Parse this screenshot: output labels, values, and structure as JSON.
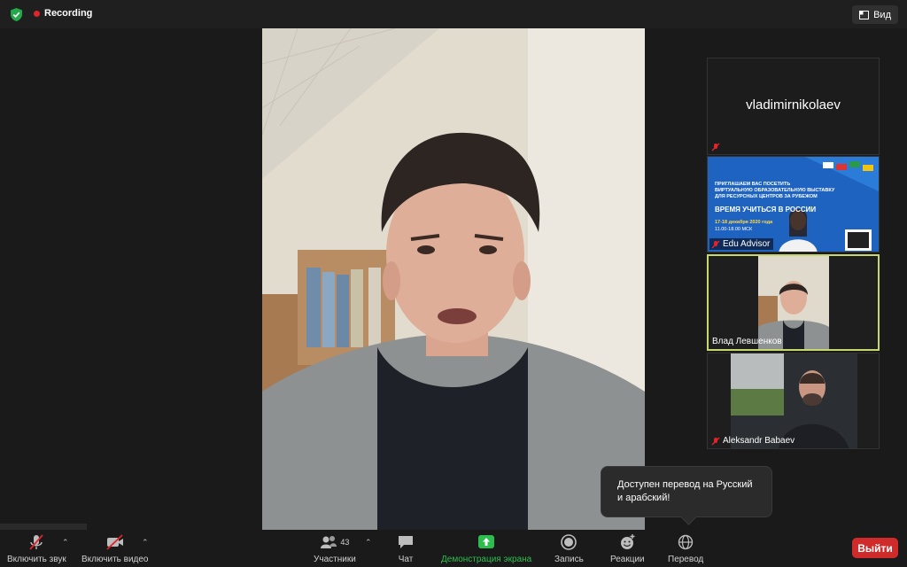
{
  "topbar": {
    "recording_label": "Recording",
    "view_label": "Вид"
  },
  "participants_panel": {
    "tiles": [
      {
        "name": "vladimirnikolaev",
        "muted": true
      },
      {
        "name": "Edu Advisor",
        "muted": true,
        "banner": {
          "line1": "ПРИГЛАШАЕМ ВАС ПОСЕТИТЬ",
          "line2": "ВИРТУАЛЬНУЮ ОБРАЗОВАТЕЛЬНУЮ ВЫСТАВКУ",
          "line3": "ДЛЯ РЕСУРСНЫХ ЦЕНТРОВ ЗА РУБЕЖОМ",
          "headline": "ВРЕМЯ УЧИТЬСЯ В РОССИИ",
          "dates": "17-18 декабря 2020 года",
          "hours": "11.00-18.00 МСК"
        }
      },
      {
        "name": "Влад Левшенков",
        "muted": false,
        "active_speaker": true
      },
      {
        "name": "Aleksandr Babaev",
        "muted": true
      }
    ]
  },
  "popup": {
    "text": "Доступен перевод на Русский и арабский!"
  },
  "toolbar": {
    "audio_label": "Включить звук",
    "video_label": "Включить видео",
    "participants_label": "Участники",
    "participants_count": "43",
    "chat_label": "Чат",
    "share_label": "Демонстрация экрана",
    "record_label": "Запись",
    "reactions_label": "Реакции",
    "translate_label": "Перевод",
    "leave_label": "Выйти"
  },
  "colors": {
    "accent_green": "#2dbd4f",
    "recording_red": "#e0242b",
    "leave_red": "#cf2b2b",
    "active_speaker_border": "#c6d76f"
  }
}
